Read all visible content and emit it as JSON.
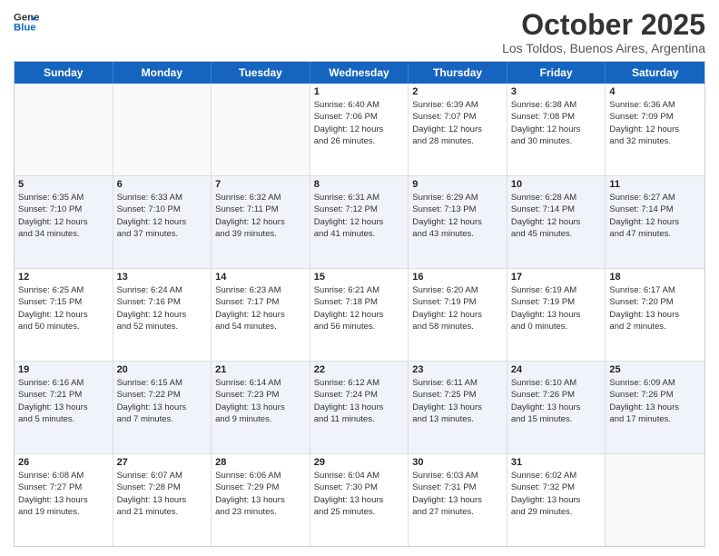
{
  "header": {
    "logo_line1": "General",
    "logo_line2": "Blue",
    "month": "October 2025",
    "location": "Los Toldos, Buenos Aires, Argentina"
  },
  "weekdays": [
    "Sunday",
    "Monday",
    "Tuesday",
    "Wednesday",
    "Thursday",
    "Friday",
    "Saturday"
  ],
  "rows": [
    [
      {
        "day": "",
        "lines": [],
        "empty": true
      },
      {
        "day": "",
        "lines": [],
        "empty": true
      },
      {
        "day": "",
        "lines": [],
        "empty": true
      },
      {
        "day": "1",
        "lines": [
          "Sunrise: 6:40 AM",
          "Sunset: 7:06 PM",
          "Daylight: 12 hours",
          "and 26 minutes."
        ]
      },
      {
        "day": "2",
        "lines": [
          "Sunrise: 6:39 AM",
          "Sunset: 7:07 PM",
          "Daylight: 12 hours",
          "and 28 minutes."
        ]
      },
      {
        "day": "3",
        "lines": [
          "Sunrise: 6:38 AM",
          "Sunset: 7:08 PM",
          "Daylight: 12 hours",
          "and 30 minutes."
        ]
      },
      {
        "day": "4",
        "lines": [
          "Sunrise: 6:36 AM",
          "Sunset: 7:09 PM",
          "Daylight: 12 hours",
          "and 32 minutes."
        ]
      }
    ],
    [
      {
        "day": "5",
        "lines": [
          "Sunrise: 6:35 AM",
          "Sunset: 7:10 PM",
          "Daylight: 12 hours",
          "and 34 minutes."
        ]
      },
      {
        "day": "6",
        "lines": [
          "Sunrise: 6:33 AM",
          "Sunset: 7:10 PM",
          "Daylight: 12 hours",
          "and 37 minutes."
        ]
      },
      {
        "day": "7",
        "lines": [
          "Sunrise: 6:32 AM",
          "Sunset: 7:11 PM",
          "Daylight: 12 hours",
          "and 39 minutes."
        ]
      },
      {
        "day": "8",
        "lines": [
          "Sunrise: 6:31 AM",
          "Sunset: 7:12 PM",
          "Daylight: 12 hours",
          "and 41 minutes."
        ]
      },
      {
        "day": "9",
        "lines": [
          "Sunrise: 6:29 AM",
          "Sunset: 7:13 PM",
          "Daylight: 12 hours",
          "and 43 minutes."
        ]
      },
      {
        "day": "10",
        "lines": [
          "Sunrise: 6:28 AM",
          "Sunset: 7:14 PM",
          "Daylight: 12 hours",
          "and 45 minutes."
        ]
      },
      {
        "day": "11",
        "lines": [
          "Sunrise: 6:27 AM",
          "Sunset: 7:14 PM",
          "Daylight: 12 hours",
          "and 47 minutes."
        ]
      }
    ],
    [
      {
        "day": "12",
        "lines": [
          "Sunrise: 6:25 AM",
          "Sunset: 7:15 PM",
          "Daylight: 12 hours",
          "and 50 minutes."
        ]
      },
      {
        "day": "13",
        "lines": [
          "Sunrise: 6:24 AM",
          "Sunset: 7:16 PM",
          "Daylight: 12 hours",
          "and 52 minutes."
        ]
      },
      {
        "day": "14",
        "lines": [
          "Sunrise: 6:23 AM",
          "Sunset: 7:17 PM",
          "Daylight: 12 hours",
          "and 54 minutes."
        ]
      },
      {
        "day": "15",
        "lines": [
          "Sunrise: 6:21 AM",
          "Sunset: 7:18 PM",
          "Daylight: 12 hours",
          "and 56 minutes."
        ]
      },
      {
        "day": "16",
        "lines": [
          "Sunrise: 6:20 AM",
          "Sunset: 7:19 PM",
          "Daylight: 12 hours",
          "and 58 minutes."
        ]
      },
      {
        "day": "17",
        "lines": [
          "Sunrise: 6:19 AM",
          "Sunset: 7:19 PM",
          "Daylight: 13 hours",
          "and 0 minutes."
        ]
      },
      {
        "day": "18",
        "lines": [
          "Sunrise: 6:17 AM",
          "Sunset: 7:20 PM",
          "Daylight: 13 hours",
          "and 2 minutes."
        ]
      }
    ],
    [
      {
        "day": "19",
        "lines": [
          "Sunrise: 6:16 AM",
          "Sunset: 7:21 PM",
          "Daylight: 13 hours",
          "and 5 minutes."
        ]
      },
      {
        "day": "20",
        "lines": [
          "Sunrise: 6:15 AM",
          "Sunset: 7:22 PM",
          "Daylight: 13 hours",
          "and 7 minutes."
        ]
      },
      {
        "day": "21",
        "lines": [
          "Sunrise: 6:14 AM",
          "Sunset: 7:23 PM",
          "Daylight: 13 hours",
          "and 9 minutes."
        ]
      },
      {
        "day": "22",
        "lines": [
          "Sunrise: 6:12 AM",
          "Sunset: 7:24 PM",
          "Daylight: 13 hours",
          "and 11 minutes."
        ]
      },
      {
        "day": "23",
        "lines": [
          "Sunrise: 6:11 AM",
          "Sunset: 7:25 PM",
          "Daylight: 13 hours",
          "and 13 minutes."
        ]
      },
      {
        "day": "24",
        "lines": [
          "Sunrise: 6:10 AM",
          "Sunset: 7:26 PM",
          "Daylight: 13 hours",
          "and 15 minutes."
        ]
      },
      {
        "day": "25",
        "lines": [
          "Sunrise: 6:09 AM",
          "Sunset: 7:26 PM",
          "Daylight: 13 hours",
          "and 17 minutes."
        ]
      }
    ],
    [
      {
        "day": "26",
        "lines": [
          "Sunrise: 6:08 AM",
          "Sunset: 7:27 PM",
          "Daylight: 13 hours",
          "and 19 minutes."
        ]
      },
      {
        "day": "27",
        "lines": [
          "Sunrise: 6:07 AM",
          "Sunset: 7:28 PM",
          "Daylight: 13 hours",
          "and 21 minutes."
        ]
      },
      {
        "day": "28",
        "lines": [
          "Sunrise: 6:06 AM",
          "Sunset: 7:29 PM",
          "Daylight: 13 hours",
          "and 23 minutes."
        ]
      },
      {
        "day": "29",
        "lines": [
          "Sunrise: 6:04 AM",
          "Sunset: 7:30 PM",
          "Daylight: 13 hours",
          "and 25 minutes."
        ]
      },
      {
        "day": "30",
        "lines": [
          "Sunrise: 6:03 AM",
          "Sunset: 7:31 PM",
          "Daylight: 13 hours",
          "and 27 minutes."
        ]
      },
      {
        "day": "31",
        "lines": [
          "Sunrise: 6:02 AM",
          "Sunset: 7:32 PM",
          "Daylight: 13 hours",
          "and 29 minutes."
        ]
      },
      {
        "day": "",
        "lines": [],
        "empty": true
      }
    ]
  ]
}
